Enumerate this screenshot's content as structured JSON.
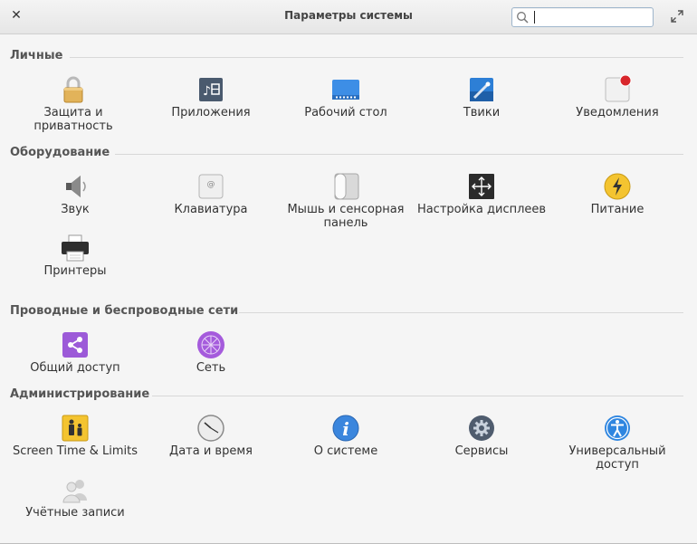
{
  "window": {
    "title": "Параметры системы",
    "search": {
      "value": "",
      "placeholder": ""
    }
  },
  "sections": [
    {
      "title": "Личные",
      "items": [
        {
          "label": "Защита и приватность",
          "icon": "lock-icon"
        },
        {
          "label": "Приложения",
          "icon": "applications-icon"
        },
        {
          "label": "Рабочий стол",
          "icon": "desktop-icon"
        },
        {
          "label": "Твики",
          "icon": "tweaks-icon"
        },
        {
          "label": "Уведомления",
          "icon": "notifications-icon"
        }
      ]
    },
    {
      "title": "Оборудование",
      "items": [
        {
          "label": "Звук",
          "icon": "speaker-icon"
        },
        {
          "label": "Клавиатура",
          "icon": "keyboard-icon"
        },
        {
          "label": "Мышь и сенсорная панель",
          "icon": "mouse-icon"
        },
        {
          "label": "Настройка дисплеев",
          "icon": "display-icon"
        },
        {
          "label": "Питание",
          "icon": "power-icon"
        },
        {
          "label": "Принтеры",
          "icon": "printer-icon"
        }
      ]
    },
    {
      "title": "Проводные и беспроводные сети",
      "items": [
        {
          "label": "Общий доступ",
          "icon": "share-icon"
        },
        {
          "label": "Сеть",
          "icon": "network-icon"
        }
      ]
    },
    {
      "title": "Администрирование",
      "items": [
        {
          "label": "Screen Time & Limits",
          "icon": "screen-time-icon"
        },
        {
          "label": "Дата и время",
          "icon": "clock-icon"
        },
        {
          "label": "О системе",
          "icon": "info-icon"
        },
        {
          "label": "Сервисы",
          "icon": "gear-icon"
        },
        {
          "label": "Универсальный доступ",
          "icon": "accessibility-icon"
        },
        {
          "label": "Учётные записи",
          "icon": "users-icon"
        }
      ]
    }
  ]
}
